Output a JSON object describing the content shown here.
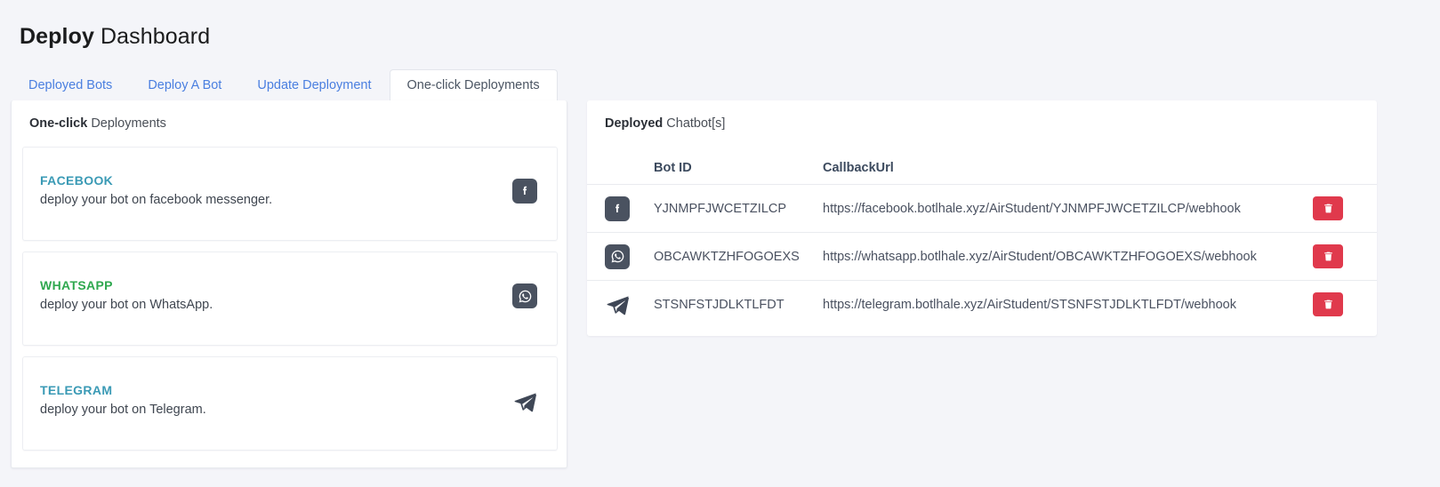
{
  "header": {
    "title_strong": "Deploy",
    "title_light": "Dashboard"
  },
  "tabs": [
    {
      "label": "Deployed Bots",
      "active": false
    },
    {
      "label": "Deploy A Bot",
      "active": false
    },
    {
      "label": "Update Deployment",
      "active": false
    },
    {
      "label": "One-click Deployments",
      "active": true
    }
  ],
  "left_panel": {
    "heading_strong": "One-click",
    "heading_light": "Deployments",
    "cards": [
      {
        "name": "FACEBOOK",
        "description": "deploy your bot on facebook messenger.",
        "color": "#3a9ab5",
        "icon": "facebook-icon"
      },
      {
        "name": "WHATSAPP",
        "description": "deploy your bot on WhatsApp.",
        "color": "#2fa84f",
        "icon": "whatsapp-icon"
      },
      {
        "name": "TELEGRAM",
        "description": "deploy your bot on Telegram.",
        "color": "#3a9ab5",
        "icon": "telegram-icon"
      }
    ]
  },
  "right_panel": {
    "heading_strong": "Deployed",
    "heading_light": "Chatbot[s]",
    "columns": {
      "bot_id": "Bot ID",
      "callback_url": "CallbackUrl"
    },
    "rows": [
      {
        "icon": "facebook-icon",
        "bot_id": "YJNMPFJWCETZILCP",
        "callback_url": "https://facebook.botlhale.xyz/AirStudent/YJNMPFJWCETZILCP/webhook",
        "delete_label": "delete"
      },
      {
        "icon": "whatsapp-icon",
        "bot_id": "OBCAWKTZHFOGOEXS",
        "callback_url": "https://whatsapp.botlhale.xyz/AirStudent/OBCAWKTZHFOGOEXS/webhook",
        "delete_label": "delete"
      },
      {
        "icon": "telegram-icon",
        "bot_id": "STSNFSTJDLKTLFDT",
        "callback_url": "https://telegram.botlhale.xyz/AirStudent/STSNFSTJDLKTLFDT/webhook",
        "delete_label": "delete"
      }
    ]
  },
  "colors": {
    "page_background": "#f4f5f9",
    "tab_link": "#4a7fe0",
    "delete_button": "#e0394c",
    "icon_tile": "#4a5260"
  }
}
